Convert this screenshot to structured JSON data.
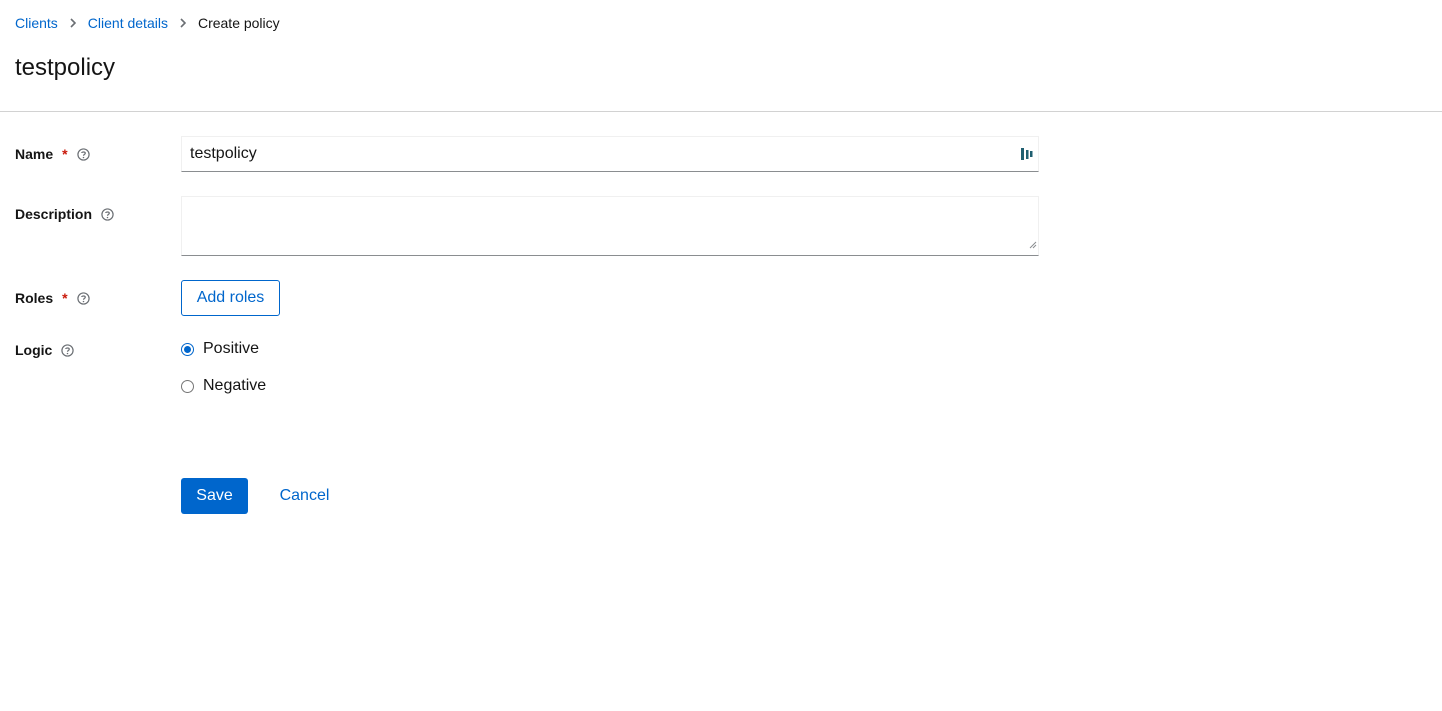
{
  "breadcrumb": {
    "items": [
      {
        "label": "Clients"
      },
      {
        "label": "Client details"
      },
      {
        "label": "Create policy"
      }
    ]
  },
  "page": {
    "title": "testpolicy"
  },
  "form": {
    "name": {
      "label": "Name",
      "required_marker": "*",
      "value": "testpolicy"
    },
    "description": {
      "label": "Description",
      "value": ""
    },
    "roles": {
      "label": "Roles",
      "required_marker": "*",
      "button_label": "Add roles"
    },
    "logic": {
      "label": "Logic",
      "options": [
        {
          "label": "Positive",
          "selected": true
        },
        {
          "label": "Negative",
          "selected": false
        }
      ]
    }
  },
  "actions": {
    "save_label": "Save",
    "cancel_label": "Cancel"
  },
  "colors": {
    "accent": "#0066cc",
    "required": "#c9190b",
    "divider": "#d2d2d2",
    "text": "#151515"
  },
  "icons": {
    "separator": "chevron-right-icon",
    "help": "question-circle-icon",
    "password_manager": "password-manager-icon"
  }
}
